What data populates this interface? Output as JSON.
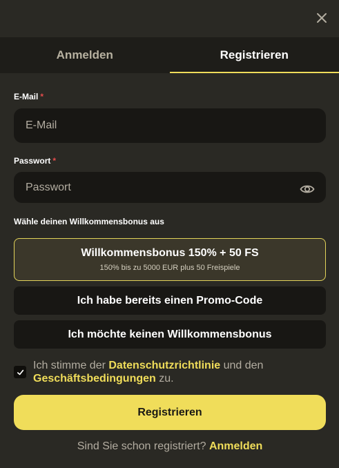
{
  "window": {
    "close_icon": "close-icon"
  },
  "tabs": [
    {
      "label": "Anmelden",
      "active": false
    },
    {
      "label": "Registrieren",
      "active": true
    }
  ],
  "form": {
    "email": {
      "label": "E-Mail",
      "required_mark": "*",
      "placeholder": "E-Mail",
      "value": ""
    },
    "password": {
      "label": "Passwort",
      "required_mark": "*",
      "placeholder": "Passwort",
      "value": "",
      "toggle_icon": "eye-icon"
    }
  },
  "bonus": {
    "heading": "Wähle deinen Willkommensbonus aus",
    "options": [
      {
        "title": "Willkommensbonus 150% + 50 FS",
        "subtitle": "150% bis zu 5000 EUR plus 50 Freispiele",
        "selected": true
      },
      {
        "title": "Ich habe bereits einen Promo-Code",
        "selected": false
      },
      {
        "title": "Ich möchte keinen Willkommensbonus",
        "selected": false
      }
    ]
  },
  "consent": {
    "checked": true,
    "text_1": "Ich stimme der ",
    "link_privacy": "Datenschutzrichtlinie",
    "text_2": " und den",
    "link_terms": "Geschäftsbedingungen",
    "text_3": " zu."
  },
  "submit_label": "Registrieren",
  "footer": {
    "prompt": "Sind Sie schon registriert?",
    "link": "Anmelden"
  },
  "colors": {
    "background": "#2a2924",
    "tab_bar": "#1e1d19",
    "input_bg": "#181714",
    "accent": "#f0dd5a",
    "required": "#e44c4c"
  }
}
